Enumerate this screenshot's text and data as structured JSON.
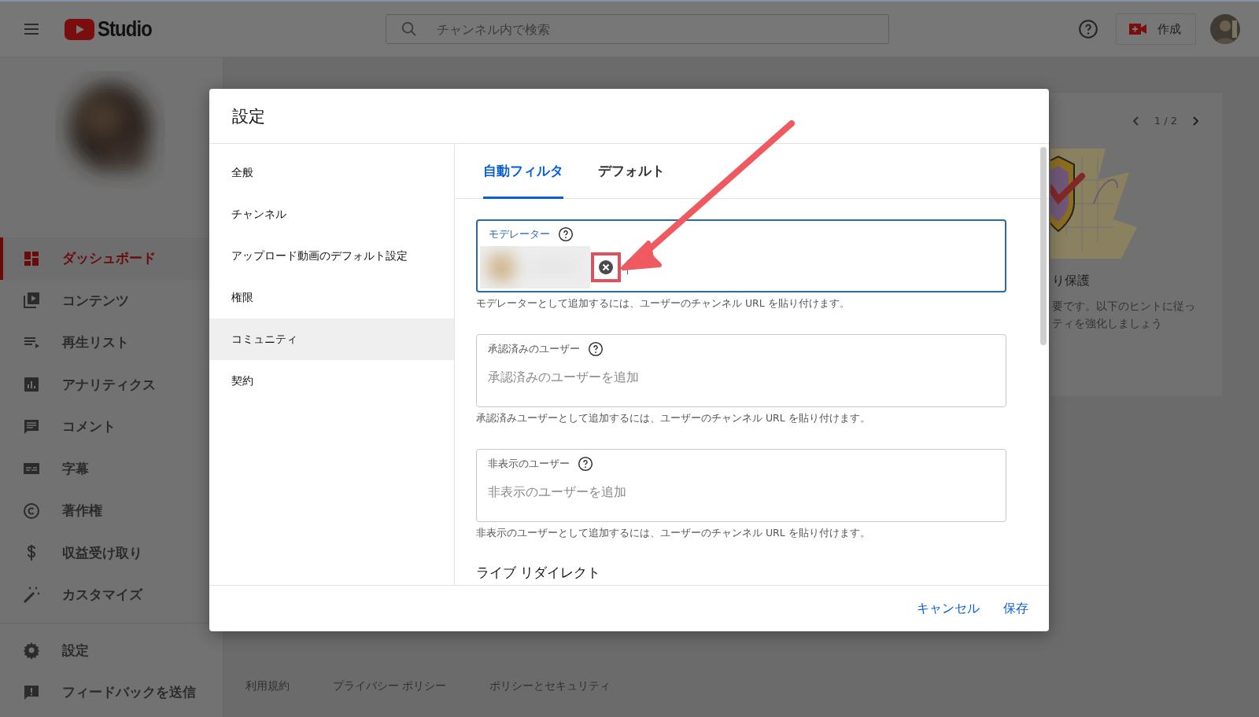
{
  "topbar": {
    "logo": "Studio",
    "search": {
      "placeholder": "チャンネル内で検索"
    },
    "create_button": "作成"
  },
  "sidebar": {
    "items": [
      {
        "label": "ダッシュボード",
        "selected": true
      },
      {
        "label": "コンテンツ",
        "selected": false
      },
      {
        "label": "再生リスト",
        "selected": false
      },
      {
        "label": "アナリティクス",
        "selected": false
      },
      {
        "label": "コメント",
        "selected": false
      },
      {
        "label": "字幕",
        "selected": false
      },
      {
        "label": "著作権",
        "selected": false
      },
      {
        "label": "収益受け取り",
        "selected": false
      },
      {
        "label": "カスタマイズ",
        "selected": false
      }
    ],
    "bottom_items": [
      {
        "label": "設定"
      },
      {
        "label": "フィードバックを送信"
      }
    ]
  },
  "promo_card": {
    "pager": "1 / 2",
    "title": "り保護",
    "text_lines": [
      "要です。以下のヒントに従っ",
      "ティを強化しましょう"
    ]
  },
  "footer_links": [
    "利用規約",
    "プライバシー ポリシー",
    "ポリシーとセキュリティ"
  ],
  "dialog": {
    "title": "設定",
    "nav": [
      {
        "label": "全般",
        "selected": false
      },
      {
        "label": "チャンネル",
        "selected": false
      },
      {
        "label": "アップロード動画のデフォルト設定",
        "selected": false
      },
      {
        "label": "権限",
        "selected": false
      },
      {
        "label": "コミュニティ",
        "selected": true
      },
      {
        "label": "契約",
        "selected": false
      }
    ],
    "tabs": [
      {
        "label": "自動フィルタ",
        "selected": true
      },
      {
        "label": "デフォルト",
        "selected": false
      }
    ],
    "fields": [
      {
        "label": "モデレーター",
        "focused": true,
        "chips": [
          {
            "kind": "picture",
            "highlighted": true
          }
        ],
        "helper": "モデレーターとして追加するには、ユーザーのチャンネル URL を貼り付けます。"
      },
      {
        "label": "承認済みのユーザー",
        "focused": false,
        "placeholder": "承認済みのユーザーを追加",
        "helper": "承認済みユーザーとして追加するには、ユーザーのチャンネル URL を貼り付けます。"
      },
      {
        "label": "非表示のユーザー",
        "focused": false,
        "placeholder": "非表示のユーザーを追加",
        "helper": "非表示のユーザーとして追加するには、ユーザーのチャンネル URL を貼り付けます。"
      }
    ],
    "section_heading": "ライブ リダイレクト",
    "actions": [
      "キャンセル",
      "保存"
    ]
  }
}
